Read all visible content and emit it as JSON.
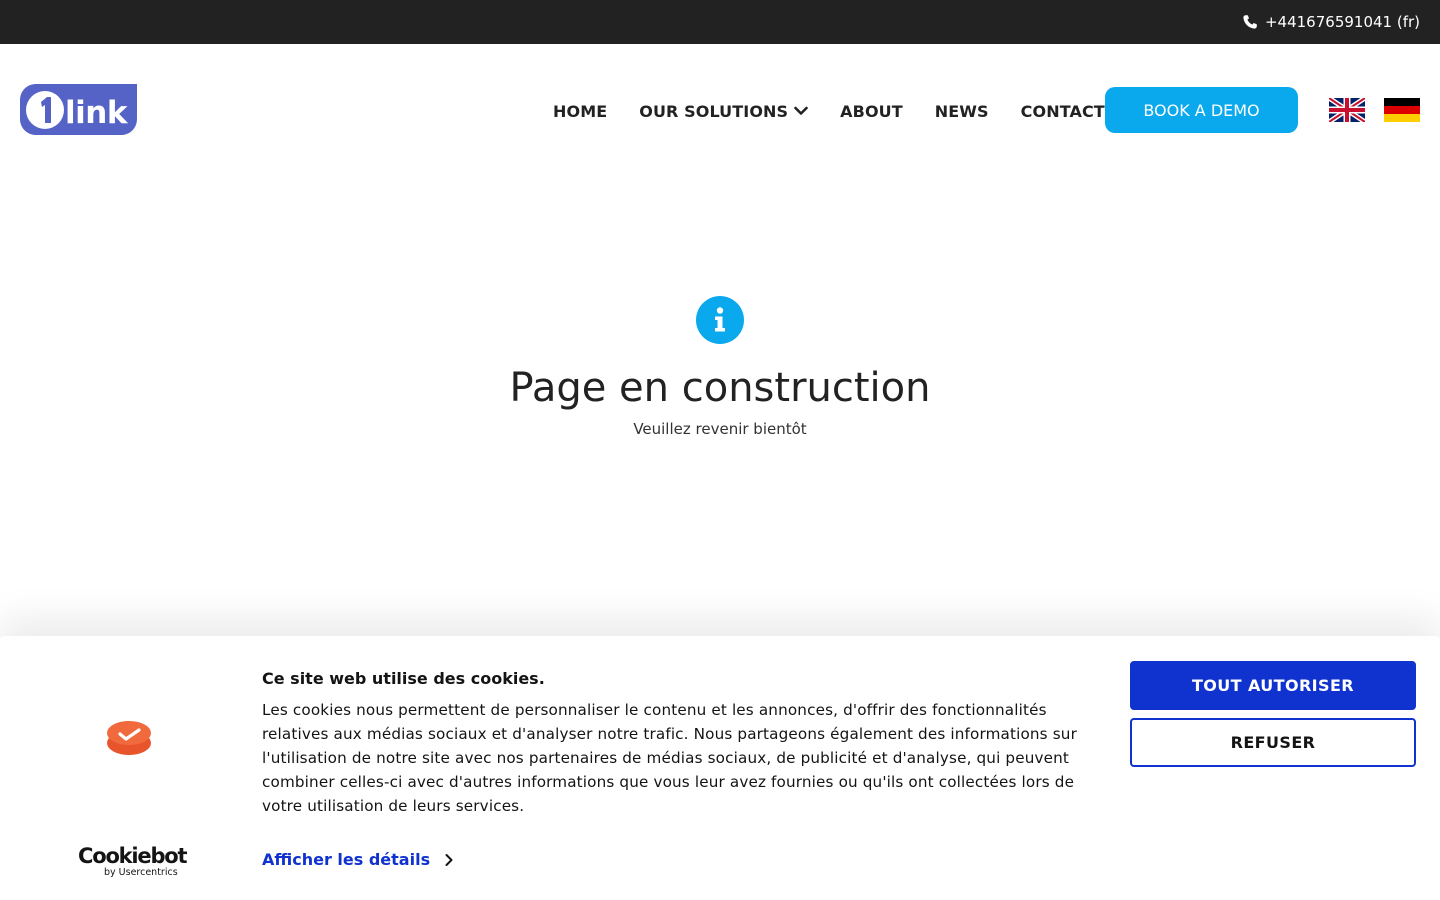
{
  "topbar": {
    "phone": "+441676591041 (fr)",
    "icon": "phone-icon"
  },
  "brand": {
    "logo_text": "link",
    "logo_digit": "1",
    "logo_color": "#5663c6"
  },
  "nav": {
    "items": [
      {
        "label": "HOME"
      },
      {
        "label": "OUR SOLUTIONS",
        "has_dropdown": true
      },
      {
        "label": "ABOUT"
      },
      {
        "label": "NEWS"
      },
      {
        "label": "CONTACT"
      }
    ],
    "demo_button": "BOOK A DEMO",
    "accent": "#0aa9ee",
    "languages": [
      "uk-flag-icon",
      "de-flag-icon"
    ]
  },
  "hero": {
    "icon": "info-icon",
    "title": "Page en construction",
    "subtitle": "Veuillez revenir bientôt"
  },
  "cookie_banner": {
    "title": "Ce site web utilise des cookies.",
    "body": "Les cookies nous permettent de personnaliser le contenu et les annonces, d'offrir des fonctionnalités relatives aux médias sociaux et d'analyser notre trafic. Nous partageons également des informations sur l'utilisation de notre site avec nos partenaires de médias sociaux, de publicité et d'analyse, qui peuvent combiner celles-ci avec d'autres informations que vous leur avez fournies ou qu'ils ont collectées lors de votre utilisation de leurs services.",
    "details_link": "Afficher les détails",
    "allow_button": "TOUT AUTORISER",
    "refuse_button": "REFUSER",
    "brand_name": "Cookiebot",
    "brand_sub": "by Usercentrics",
    "accent": "#1032cf"
  }
}
